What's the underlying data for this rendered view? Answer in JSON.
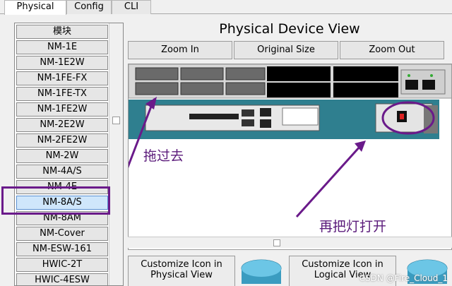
{
  "tabs": [
    {
      "label": "Physical",
      "active": true
    },
    {
      "label": "Config",
      "active": false
    },
    {
      "label": "CLI",
      "active": false
    }
  ],
  "module_list": {
    "items": [
      "模块",
      "NM-1E",
      "NM-1E2W",
      "NM-1FE-FX",
      "NM-1FE-TX",
      "NM-1FE2W",
      "NM-2E2W",
      "NM-2FE2W",
      "NM-2W",
      "NM-4A/S",
      "NM-4E",
      "NM-8A/S",
      "NM-8AM",
      "NM-Cover",
      "NM-ESW-161",
      "HWIC-2T",
      "HWIC-4ESW"
    ],
    "selected": "NM-8A/S"
  },
  "device_view": {
    "title": "Physical Device View",
    "zoom_in": "Zoom In",
    "original_size": "Original Size",
    "zoom_out": "Zoom Out",
    "customize_physical": "Customize Icon in Physical View",
    "customize_logical": "Customize Icon in Logical View"
  },
  "annotations": {
    "drag": "拖过去",
    "power_on": "再把灯打开"
  },
  "watermark": "CSDN @Fire_Cloud_1",
  "colors": {
    "annotation": "#6a1a8a",
    "device_teal": "#2f7f8f",
    "selected_item": "#cfe6fb"
  }
}
